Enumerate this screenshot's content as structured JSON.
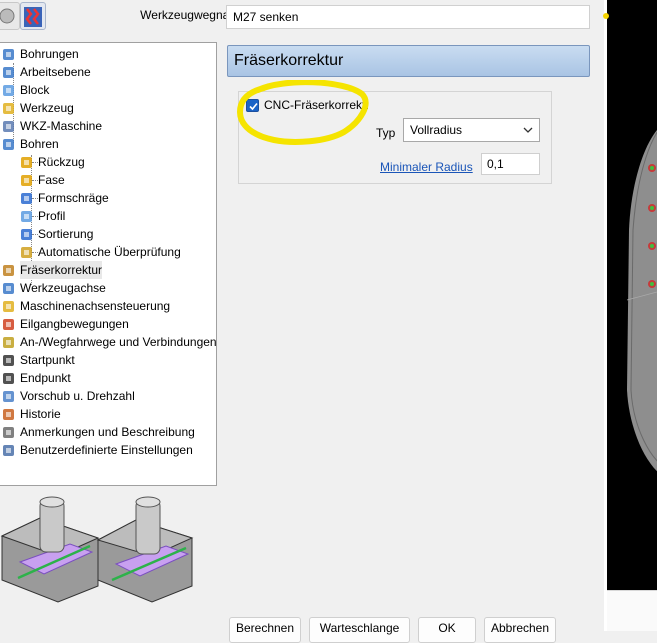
{
  "toolbar": {
    "name_label": "Werkzeugwegname",
    "name_value": "M27 senken"
  },
  "tree": {
    "items": [
      {
        "label": "Bohrungen",
        "icon": "drill-holes-icon"
      },
      {
        "label": "Arbeitsebene",
        "icon": "work-plane-icon"
      },
      {
        "label": "Block",
        "icon": "block-icon"
      },
      {
        "label": "Werkzeug",
        "icon": "tool-icon"
      },
      {
        "label": "WKZ-Maschine",
        "icon": "tool-machine-icon"
      },
      {
        "label": "Bohren",
        "icon": "drilling-icon"
      },
      {
        "label": "Rückzug",
        "icon": "retract-icon"
      },
      {
        "label": "Fase",
        "icon": "chamfer-icon"
      },
      {
        "label": "Formschräge",
        "icon": "draft-angle-icon"
      },
      {
        "label": "Profil",
        "icon": "profile-icon"
      },
      {
        "label": "Sortierung",
        "icon": "sorting-icon"
      },
      {
        "label": "Automatische Überprüfung",
        "icon": "auto-check-icon"
      },
      {
        "label": "Fräserkorrektur",
        "icon": "cutter-compensation-icon"
      },
      {
        "label": "Werkzeugachse",
        "icon": "tool-axis-icon"
      },
      {
        "label": "Maschinenachsensteuerung",
        "icon": "machine-axis-control-icon"
      },
      {
        "label": "Eilgangbewegungen",
        "icon": "rapid-moves-icon"
      },
      {
        "label": "An-/Wegfahrwege und Verbindungen",
        "icon": "leads-links-icon"
      },
      {
        "label": "Startpunkt",
        "icon": "start-point-icon"
      },
      {
        "label": "Endpunkt",
        "icon": "end-point-icon"
      },
      {
        "label": "Vorschub u. Drehzahl",
        "icon": "feeds-speeds-icon"
      },
      {
        "label": "Historie",
        "icon": "history-icon"
      },
      {
        "label": "Anmerkungen und Beschreibung",
        "icon": "notes-icon"
      },
      {
        "label": "Benutzerdefinierte Einstellungen",
        "icon": "user-settings-icon"
      }
    ],
    "selected": "Fräserkorrektur"
  },
  "panel": {
    "title": "Fräserkorrektur",
    "cnc_label": "CNC-Fräserkorrektur",
    "cnc_checked": true,
    "typ_label": "Typ",
    "typ_value": "Vollradius",
    "min_radius_label": "Minimaler Radius",
    "min_radius_value": "0,1"
  },
  "buttons": {
    "calculate": "Berechnen",
    "queue": "Warteschlange",
    "ok": "OK",
    "cancel": "Abbrechen"
  },
  "colors": {
    "header_top": "#c9dcf1",
    "header_bottom": "#a9c4e4",
    "accent": "#1a63c7",
    "highlight": "#f5e400",
    "viewport_bg": "#000000",
    "part_gray": "#8e8e8e"
  }
}
